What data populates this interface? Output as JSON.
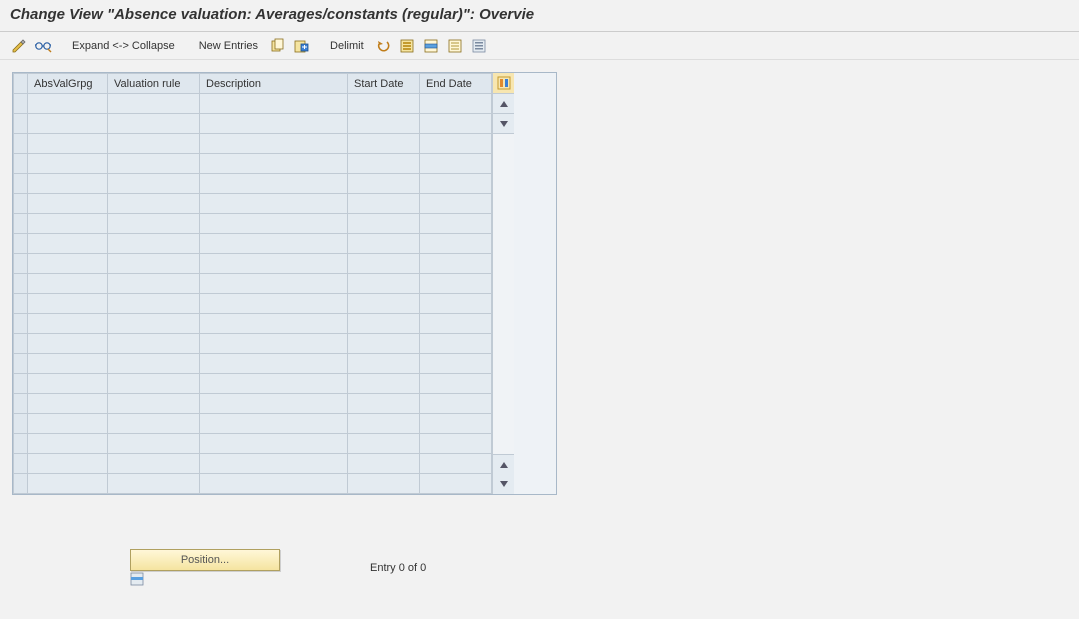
{
  "header": {
    "title": "Change View \"Absence valuation: Averages/constants (regular)\": Overvie"
  },
  "toolbar": {
    "expand_collapse_label": "Expand <-> Collapse",
    "new_entries_label": "New Entries",
    "delimit_label": "Delimit"
  },
  "table": {
    "columns": {
      "abs_val_grpg": "AbsValGrpg",
      "valuation_rule": "Valuation rule",
      "description": "Description",
      "start_date": "Start Date",
      "end_date": "End Date"
    },
    "row_count": 20
  },
  "footer": {
    "position_label": "Position...",
    "entry_text": "Entry 0 of 0"
  }
}
